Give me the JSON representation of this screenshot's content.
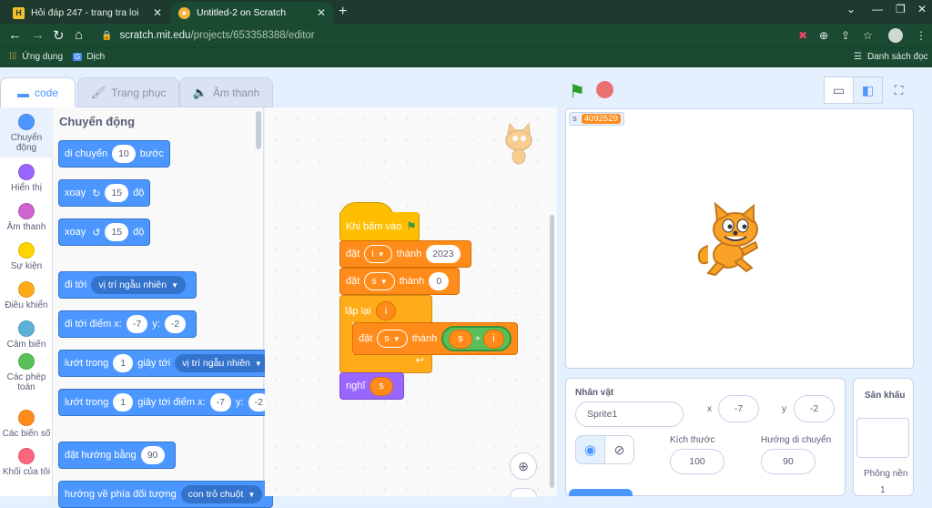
{
  "browser": {
    "tabs": [
      {
        "title": "Hỏi đáp 247 - trang tra loi",
        "icon": "h-logo-icon"
      },
      {
        "title": "Untitled-2 on Scratch",
        "icon": "scratch-favicon-icon"
      }
    ],
    "url_host": "scratch.mit.edu",
    "url_path": "/projects/653358388/editor",
    "bookmarks": [
      {
        "label": "Ứng dụng"
      },
      {
        "label": "Dịch"
      }
    ],
    "reading_list": "Danh sách đọc"
  },
  "editor": {
    "tabs": {
      "code": "code",
      "costumes": "Trang phục",
      "sounds": "Âm thanh"
    }
  },
  "categories": [
    {
      "label": "Chuyển động",
      "color": "#4c97ff"
    },
    {
      "label": "Hiển thị",
      "color": "#9966ff"
    },
    {
      "label": "Âm thanh",
      "color": "#cf63cf"
    },
    {
      "label": "Sự kiện",
      "color": "#ffd500"
    },
    {
      "label": "Điều khiển",
      "color": "#ffab19"
    },
    {
      "label": "Cảm biến",
      "color": "#5cb1d6"
    },
    {
      "label": "Các phép toán",
      "color": "#59c059"
    },
    {
      "label": "Các biến số",
      "color": "#ff8c1a"
    },
    {
      "label": "Khối của tôi",
      "color": "#ff6680"
    }
  ],
  "palette": {
    "title": "Chuyển động",
    "move": {
      "a": "di chuyển",
      "n": "10",
      "b": "bước"
    },
    "turn_right": {
      "a": "xoay",
      "n": "15",
      "b": "độ"
    },
    "turn_left": {
      "a": "xoay",
      "n": "15",
      "b": "độ"
    },
    "goto": {
      "a": "đi tới",
      "dd": "vị trí ngẫu nhiên"
    },
    "goto_xy": {
      "a": "đi tới điểm x:",
      "x": "-7",
      "y_label": "y:",
      "y": "-2"
    },
    "glide": {
      "a": "lướt trong",
      "n": "1",
      "b": "giây tới",
      "dd": "vị trí ngẫu nhiên"
    },
    "glide_xy": {
      "a": "lướt trong",
      "n": "1",
      "b": "giây tới điểm x:",
      "x": "-7",
      "y_label": "y:",
      "y": "-2"
    },
    "point": {
      "a": "đặt hướng bằng",
      "n": "90"
    },
    "point_towards": {
      "a": "hướng về phía đối tượng",
      "dd": "con trỏ chuột"
    }
  },
  "script": {
    "hat": "Khi bấm vào",
    "set1": {
      "a": "đặt",
      "var": "i",
      "b": "thành",
      "v": "2023"
    },
    "set2": {
      "a": "đặt",
      "var": "s",
      "b": "thành",
      "v": "0"
    },
    "repeat": {
      "a": "lặp lại",
      "v": "i"
    },
    "set3": {
      "a": "đặt",
      "var": "s",
      "b": "thành",
      "left": "s",
      "op": "+",
      "right": "i"
    },
    "think": {
      "a": "nghĩ",
      "v": "s"
    }
  },
  "stage": {
    "monitor_name": "s",
    "monitor_value": "4092529"
  },
  "sprite": {
    "label": "Nhân vật",
    "name": "Sprite1",
    "x_label": "x",
    "x": "-7",
    "y_label": "y",
    "y": "-2",
    "size_label": "Kích thước",
    "size": "100",
    "dir_label": "Hướng di chuyển",
    "dir": "90"
  },
  "stagepanel": {
    "title": "Sân khấu",
    "backdrops_label": "Phông nền",
    "backdrops": "1"
  }
}
